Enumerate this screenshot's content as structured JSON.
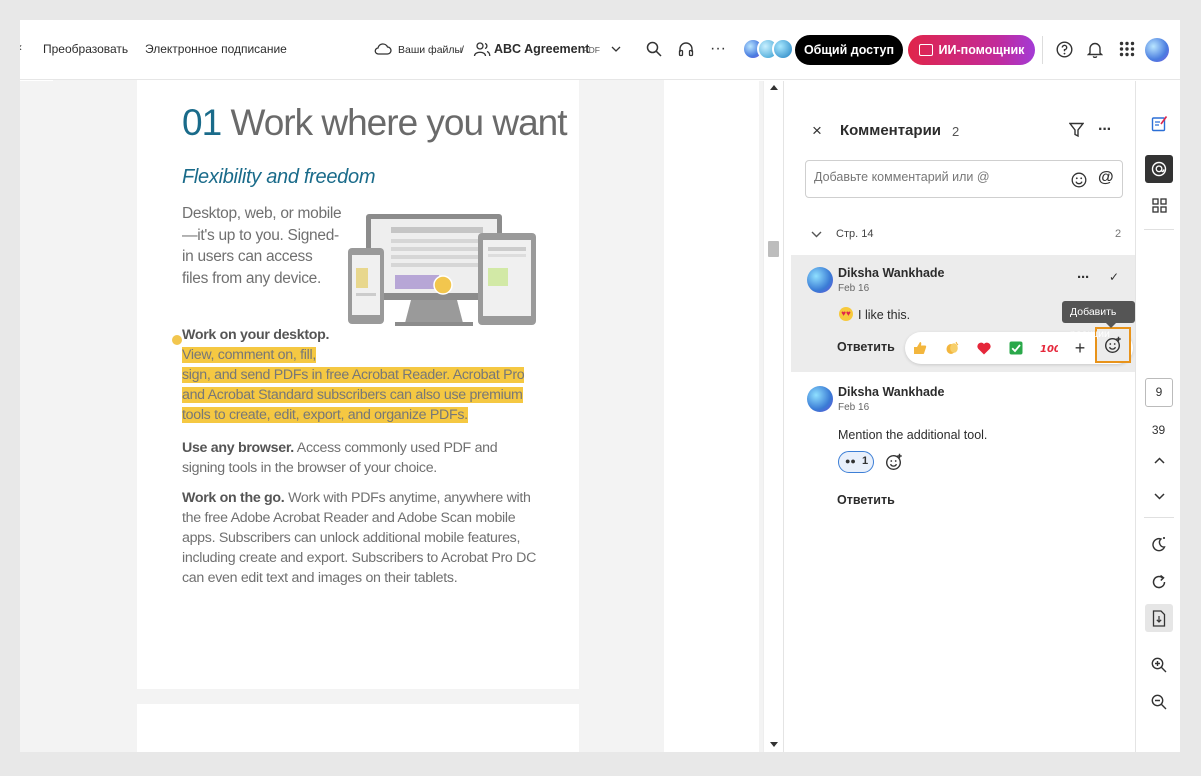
{
  "toolbar": {
    "convert": "Преобразовать",
    "esign": "Электронное подписание",
    "your_files": "Ваши файлы",
    "separator": "/",
    "doc_title": "ABC Agreement",
    "doc_type": "PDF",
    "share_label": "Общий доступ",
    "ai_label": "ИИ-помощник"
  },
  "document": {
    "heading_num": "01",
    "heading_text": "Work where you want",
    "subheading": "Flexibility and freedom",
    "intro": "Desktop, web, or mobile—it's up to you. Signed-in users can access files from any device.",
    "p1_bold": "Work on your desktop.",
    "p1_hl_a": "View, comment on, fill,",
    "p1_hl_b": "sign, and send PDFs in free Acrobat Reader. Acrobat Pro and Acrobat Standard subscribers can also use premium tools to create, edit, export, and organize PDFs.",
    "p2_bold": "Use any browser.",
    "p2_text": "Access commonly used PDF and signing tools in the browser of your choice.",
    "p3_bold": "Work on the go.",
    "p3_text": "Work with PDFs anytime, anywhere with the free Adobe Acrobat Reader and Adobe Scan mobile apps. Subscribers can unlock additional mobile features, including create and export. Subscribers to Acrobat Pro DC can even edit text and images on their tablets."
  },
  "comments": {
    "title": "Комментарии",
    "count": "2",
    "input_placeholder": "Добавьте комментарий или @",
    "page_label": "Стр. 14",
    "page_count": "2",
    "tooltip": "Добавить реакции",
    "threads": [
      {
        "author": "Diksha Wankhade",
        "date": "Feb 16",
        "text": "I like this.",
        "reply": "Ответить"
      },
      {
        "author": "Diksha Wankhade",
        "date": "Feb 16",
        "text": "Mention the additional tool.",
        "reaction_count": "1",
        "reply": "Ответить"
      }
    ]
  },
  "rail": {
    "page_current": "9",
    "page_total": "39"
  },
  "colors": {
    "accent_blue": "#1a6b8a",
    "highlight": "#f5c842",
    "share_bg": "#000000",
    "ai_bg": "#e0254a",
    "focus_orange": "#e8931a"
  }
}
